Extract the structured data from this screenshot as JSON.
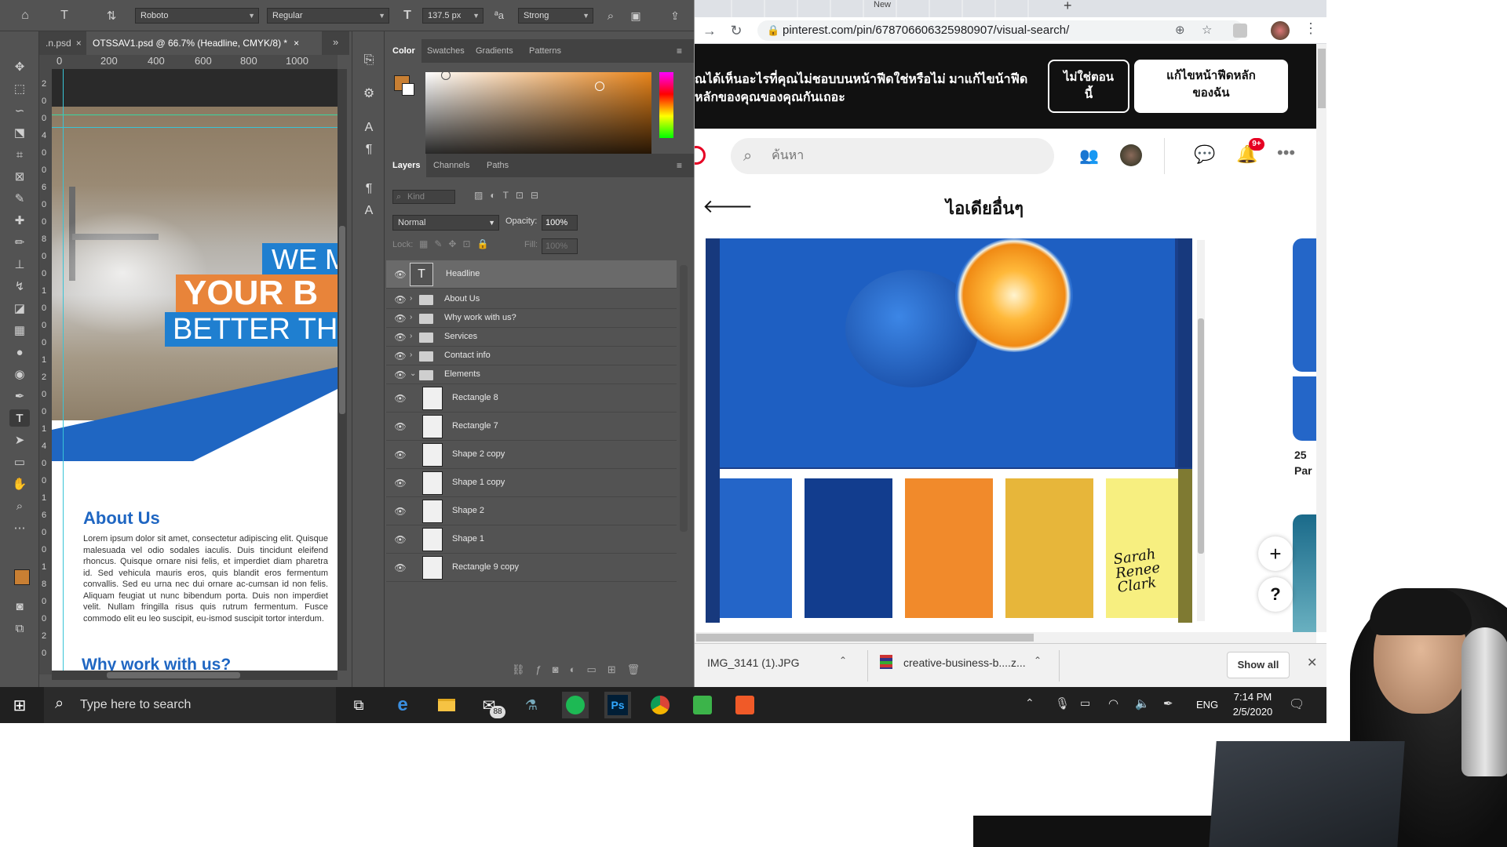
{
  "photoshop": {
    "options_bar": {
      "font_family": "Roboto",
      "font_style": "Regular",
      "font_size": "137.5 px",
      "aa_label": "ªa",
      "antialias": "Strong"
    },
    "doc_tabs": [
      {
        "label": ".n.psd"
      },
      {
        "label": "OTSSAV1.psd @ 66.7% (Headline, CMYK/8) *"
      }
    ],
    "ruler_top": [
      "0",
      "200",
      "400",
      "600",
      "800",
      "1000"
    ],
    "ruler_left": [
      "2",
      "0",
      "0",
      "4",
      "0",
      "0",
      "6",
      "0",
      "0",
      "8",
      "0",
      "0",
      "1",
      "0",
      "0",
      "0",
      "1",
      "2",
      "0",
      "0",
      "1",
      "4",
      "0",
      "0",
      "1",
      "6",
      "0",
      "0",
      "1",
      "8",
      "0",
      "0",
      "2",
      "0"
    ],
    "canvas": {
      "headline_lines": [
        "WE M",
        "YOUR B",
        "BETTER TH"
      ],
      "about_title": "About Us",
      "about_body": "Lorem ipsum dolor sit amet, consectetur adipiscing elit. Quisque malesuada vel odio sodales iaculis. Duis tincidunt eleifend rhoncus. Quisque ornare nisi felis, et imperdiet diam pharetra id. Sed vehicula mauris eros, quis blandit eros fermentum convallis. Sed eu urna nec dui ornare ac-cumsan id non felis. Aliquam feugiat ut nunc bibendum porta. Duis non imperdiet velit. Nullam fringilla risus quis rutrum fermentum. Fusce commodo elit eu leo suscipit, eu-ismod suscipit tortor interdum.",
      "why_title": "Why work with us?"
    },
    "color_panel": {
      "tabs": [
        "Color",
        "Swatches",
        "Gradients",
        "Patterns"
      ],
      "foreground_color": "#c87f33",
      "background_color": "#ffffff"
    },
    "layers_panel": {
      "tabs": [
        "Layers",
        "Channels",
        "Paths"
      ],
      "filter_placeholder": "Kind",
      "blend_mode": "Normal",
      "opacity_label": "Opacity:",
      "opacity_value": "100%",
      "lock_label": "Lock:",
      "fill_label": "Fill:",
      "fill_value": "100%",
      "layers": [
        {
          "name": "Headline",
          "kind": "text",
          "selected": true
        },
        {
          "name": "About Us",
          "kind": "group"
        },
        {
          "name": "Why work with us?",
          "kind": "group"
        },
        {
          "name": "Services",
          "kind": "group"
        },
        {
          "name": "Contact info",
          "kind": "group"
        },
        {
          "name": "Elements",
          "kind": "group-open"
        },
        {
          "name": "Rectangle 8",
          "kind": "shape"
        },
        {
          "name": "Rectangle 7",
          "kind": "shape"
        },
        {
          "name": "Shape 2 copy",
          "kind": "shape"
        },
        {
          "name": "Shape 1 copy",
          "kind": "shape"
        },
        {
          "name": "Shape 2",
          "kind": "shape"
        },
        {
          "name": "Shape 1",
          "kind": "shape"
        },
        {
          "name": "Rectangle 9 copy",
          "kind": "shape"
        }
      ]
    }
  },
  "chrome": {
    "tab_new_label": "New",
    "url": "pinterest.com/pin/678706606325980907/visual-search/",
    "banner": {
      "message": "ณได้เห็นอะไรที่คุณไม่ชอบบนหน้าฟีดใช่หรือไม่ มาแก้ไขน้าฟีดหลักของคุณของคุณกันเถอะ",
      "btn_not_now": "ไม่ใช่ตอนนี้",
      "btn_edit_feed": "แก้ไขหน้าฟีดหลักของฉัน"
    },
    "pinterest": {
      "search_placeholder": "ค้นหา",
      "notifications_badge": "9+",
      "page_title": "ไอเดียอื่นๆ",
      "side_text_1": "25",
      "side_text_2": "Par",
      "fab_plus": "+",
      "fab_help": "?",
      "palette_colors": [
        "#2465c8",
        "#123d8e",
        "#f18a2b",
        "#e7b63a",
        "#f7ef80"
      ],
      "signature_text": "Sarah Renee Clark"
    },
    "downloads": {
      "items": [
        "IMG_3141 (1).JPG",
        "creative-business-b....z..."
      ],
      "show_all": "Show all"
    }
  },
  "taskbar": {
    "search_placeholder": "Type here to search",
    "mail_badge": "88",
    "ps_label": "Ps",
    "language": "ENG",
    "time": "7:14 PM",
    "date": "2/5/2020"
  }
}
